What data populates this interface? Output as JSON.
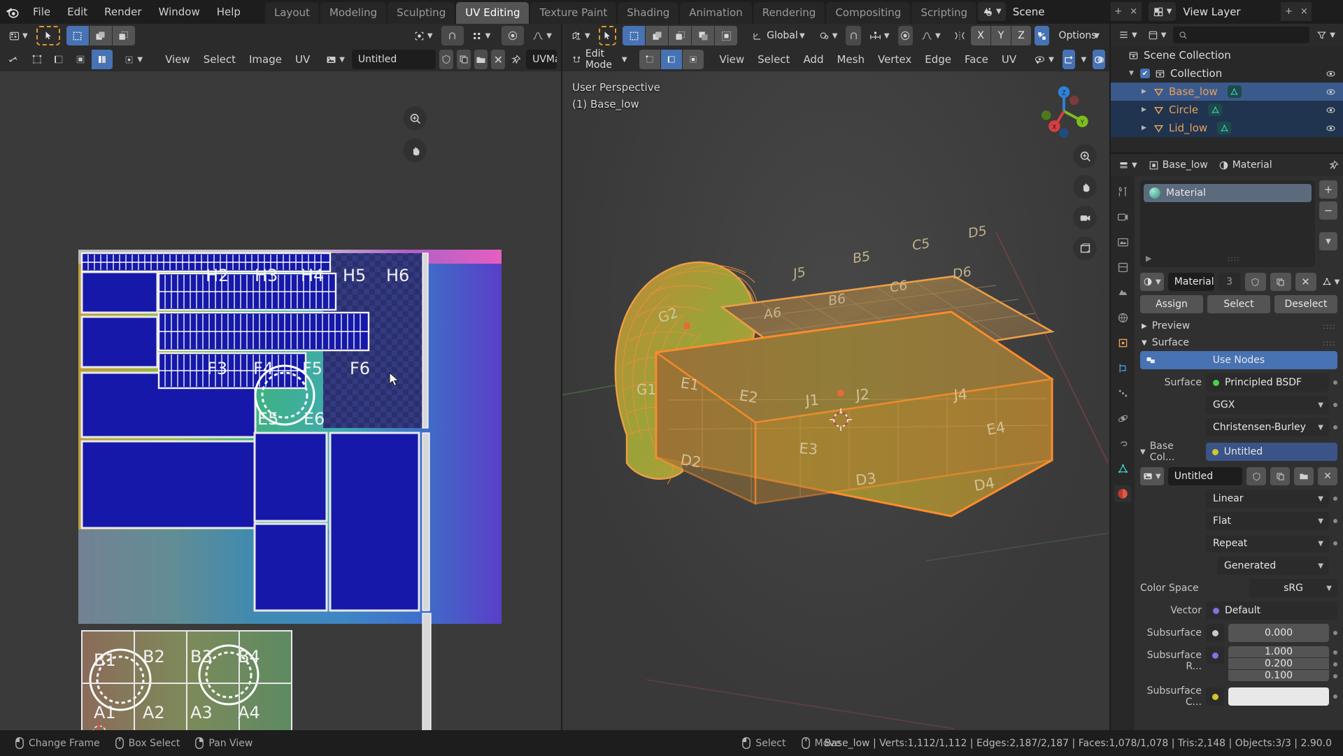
{
  "app": {
    "name": "Blender",
    "version": "2.90.0"
  },
  "topbar": {
    "logo_icon": "blender-logo-icon",
    "menus": [
      "File",
      "Edit",
      "Render",
      "Window",
      "Help"
    ],
    "workspace_tabs": [
      {
        "label": "Layout",
        "active": false
      },
      {
        "label": "Modeling",
        "active": false
      },
      {
        "label": "Sculpting",
        "active": false
      },
      {
        "label": "UV Editing",
        "active": true
      },
      {
        "label": "Texture Paint",
        "active": false
      },
      {
        "label": "Shading",
        "active": false
      },
      {
        "label": "Animation",
        "active": false
      },
      {
        "label": "Rendering",
        "active": false
      },
      {
        "label": "Compositing",
        "active": false
      },
      {
        "label": "Scripting",
        "active": false
      }
    ],
    "add_workspace_label": "+",
    "scene_icon": "scene-icon",
    "scene_name": "Scene",
    "new_scene_label": "+",
    "delete_scene_label": "×",
    "view_layer_icon": "view-layer-icon",
    "view_layer_name": "View Layer",
    "new_layer_label": "+",
    "delete_layer_label": "×"
  },
  "uv_editor": {
    "editor_type_icon": "uv-editor-icon",
    "mode_icon": "cursor-select-icon",
    "select_modes": [
      "select-set-icon",
      "select-extend-icon",
      "select-subtract-icon"
    ],
    "pivot_icon": "pivot-point-icon",
    "snap_icon": "snap-magnet-icon",
    "snap_target_icon": "snap-target-icon",
    "proportional_icon": "proportional-edit-icon",
    "falloff_icon": "smooth-falloff-icon",
    "uv_sync_icon": "uv-sync-selection-icon",
    "uv_select_modes": [
      "vertex-icon",
      "edge-icon",
      "face-icon",
      "island-icon"
    ],
    "sticky_icon": "sticky-selection-icon",
    "menus": [
      "View",
      "Select",
      "Image",
      "UV"
    ],
    "image_browse_icon": "image-browse-icon",
    "image_name": "Untitled",
    "fake_user_icon": "shield-icon",
    "copy_icon": "copy-icon",
    "open_icon": "folder-icon",
    "unlink_icon": "x-icon",
    "pin_icon": "pin-icon",
    "uv_map_label": "UVMa",
    "uv_labels_top": [
      "H2",
      "H3",
      "H4",
      "H5",
      "H6"
    ],
    "uv_labels_mid": [
      "F3",
      "F4",
      "F5",
      "F6"
    ],
    "uv_labels_mid2": [
      "E5",
      "E6"
    ],
    "uv_labels_bottom": [
      "B1",
      "B2",
      "B3",
      "B4",
      "A1",
      "A2",
      "A3",
      "A4"
    ],
    "cursor_label": "2d-cursor-icon",
    "zoom_icon": "zoom-icon",
    "hand_icon": "pan-hand-icon"
  },
  "viewport3d": {
    "editor_type_icon": "viewport-3d-icon",
    "mode_label": "Edit Mode",
    "mesh_select_modes": [
      "vertex-select-icon",
      "edge-select-icon",
      "face-select-icon"
    ],
    "menus": [
      "View",
      "Select",
      "Add",
      "Mesh",
      "Vertex",
      "Edge",
      "Face",
      "UV"
    ],
    "transform_orientation": "Global",
    "pivot_icon": "pivot-point-icon",
    "snap_icon": "snap-magnet-icon",
    "snap_target_icon": "snap-increment-icon",
    "proportional_icon": "proportional-edit-icon",
    "falloff_icon": "smooth-falloff-icon",
    "mirror_icon": "x-mirror-icon",
    "mirror_axes": [
      "X",
      "Y",
      "Z"
    ],
    "options_label": "Options",
    "visibility_icon": "eye-icon",
    "gizmo_icon": "gizmo-icon",
    "overlays_icon": "overlays-icon",
    "xray_icon": "xray-icon",
    "shading_icon": "shading-icon",
    "perspective_label": "User Perspective",
    "object_label": "(1) Base_low",
    "gizmo_axes": [
      "X",
      "Y",
      "Z"
    ],
    "nav_tools": [
      "zoom-icon",
      "pan-hand-icon",
      "camera-icon",
      "ortho-persp-icon"
    ],
    "face_labels": [
      "G1",
      "G2",
      "J5",
      "B5",
      "C5",
      "D5",
      "A6",
      "B6",
      "C6",
      "D6",
      "E1",
      "E2",
      "E3",
      "E4",
      "J1",
      "J2",
      "D2",
      "D3",
      "D4"
    ]
  },
  "outliner": {
    "display_mode_icon": "outliner-icon",
    "filter_icon": "filter-icon",
    "search_icon": "search-icon",
    "search_placeholder": "",
    "rows": [
      {
        "label": "Scene Collection",
        "icon": "scene-collection-icon",
        "indent": 0,
        "selected": false,
        "has_checkbox": false,
        "has_eye": false,
        "expander": ""
      },
      {
        "label": "Collection",
        "icon": "collection-icon",
        "indent": 1,
        "selected": false,
        "has_checkbox": true,
        "has_eye": true,
        "expander": "▼"
      },
      {
        "label": "Base_low",
        "icon": "mesh-object-icon",
        "indent": 2,
        "selected": true,
        "has_checkbox": false,
        "has_eye": true,
        "expander": "▶",
        "data_icon": "mesh-data-icon"
      },
      {
        "label": "Circle",
        "icon": "mesh-object-icon",
        "indent": 2,
        "selected": false,
        "sub": true,
        "has_checkbox": false,
        "has_eye": true,
        "expander": "▶",
        "data_icon": "mesh-data-icon"
      },
      {
        "label": "Lid_low",
        "icon": "mesh-object-icon",
        "indent": 2,
        "selected": false,
        "sub": true,
        "has_checkbox": false,
        "has_eye": true,
        "expander": "▶",
        "data_icon": "mesh-data-icon"
      }
    ]
  },
  "properties": {
    "editor_icon": "properties-icon",
    "breadcrumb_object_icon": "object-icon",
    "breadcrumb_object": "Base_low",
    "breadcrumb_material_icon": "material-icon",
    "breadcrumb_material": "Material",
    "pin_icon": "pin-icon",
    "tabs": [
      "tool-icon",
      "render-icon",
      "output-icon",
      "view-layer-icon",
      "scene-icon",
      "world-icon",
      "object-icon",
      "modifier-icon",
      "particles-icon",
      "physics-icon",
      "constraints-icon",
      "object-data-icon",
      "material-icon"
    ],
    "active_tab_index": 12,
    "material_slot": "Material",
    "slot_add_label": "+",
    "slot_remove_label": "−",
    "slot_menu_label": "∨",
    "material_browse_icon": "material-browse-icon",
    "material_name": "Material",
    "material_users": "3",
    "fake_user_icon": "shield-icon",
    "copy_icon": "copy-icon",
    "unlink_icon": "x-icon",
    "slot_link_icon": "mesh-link-icon",
    "assign_label": "Assign",
    "select_label": "Select",
    "deselect_label": "Deselect",
    "preview_label": "Preview",
    "surface_label": "Surface",
    "use_nodes_label": "Use Nodes",
    "use_nodes_icon": "nodes-icon",
    "surface_field_label": "Surface",
    "surface_value": "Principled BSDF",
    "distribution_value": "GGX",
    "subsurface_method_value": "Christensen-Burley",
    "base_color_label": "Base Col...",
    "base_color_value": "Untitled",
    "image_browse_icon": "image-browse-icon",
    "image_name": "Untitled",
    "image_fake_user_icon": "shield-icon",
    "image_copy_icon": "copy-icon",
    "image_open_icon": "folder-icon",
    "image_unlink_icon": "x-icon",
    "interpolation_value": "Linear",
    "projection_value": "Flat",
    "extension_value": "Repeat",
    "source_value": "Generated",
    "color_space_label": "Color Space",
    "color_space_value": "sRG",
    "vector_label": "Vector",
    "vector_value": "Default",
    "subsurface_label": "Subsurface",
    "subsurface_value": "0.000",
    "subsurface_radius_label": "Subsurface R...",
    "subsurface_radius_values": [
      "1.000",
      "0.200",
      "0.100"
    ],
    "subsurface_color_label": "Subsurface C..."
  },
  "statusbar": {
    "keymap": [
      {
        "icon": "mouse-left-icon",
        "label": "Change Frame"
      },
      {
        "icon": "mouse-middle-icon",
        "label": "Box Select"
      },
      {
        "icon": "mouse-right-icon",
        "label": "Pan View"
      },
      {
        "icon": "mouse-left-icon",
        "label": "Select"
      },
      {
        "icon": "mouse-middle-icon",
        "label": "Move"
      }
    ],
    "stats": "Base_low | Verts:1,112/1,112 | Edges:2,187/2,187 | Faces:1,078/1,078 | Tris:2,148 | Objects:3/3 | 2.90.0"
  },
  "colors": {
    "accent_blue": "#4772b3",
    "header_bg": "#2b2b2b",
    "panel_bg": "#303030",
    "outliner_bg": "#282828",
    "selected_orange": "#ed9e4a",
    "uv_island_blue": "#1518a8",
    "topbar_bg": "#1d1d1d"
  }
}
